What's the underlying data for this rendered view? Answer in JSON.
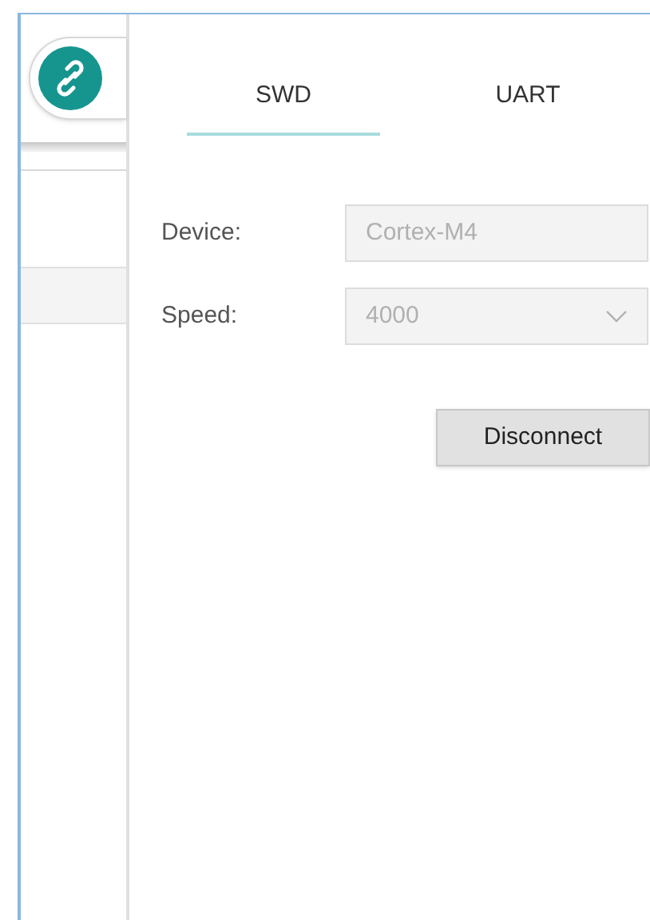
{
  "tabs": [
    {
      "label": "SWD",
      "selected": true
    },
    {
      "label": "UART",
      "selected": false
    }
  ],
  "fields": [
    {
      "kind": "text",
      "label": "Device:",
      "value": "Cortex-M4",
      "disabled": true
    },
    {
      "kind": "dropdown",
      "label": "Speed:",
      "value": "4000",
      "disabled": true
    }
  ],
  "buttons": [
    "Disconnect"
  ]
}
